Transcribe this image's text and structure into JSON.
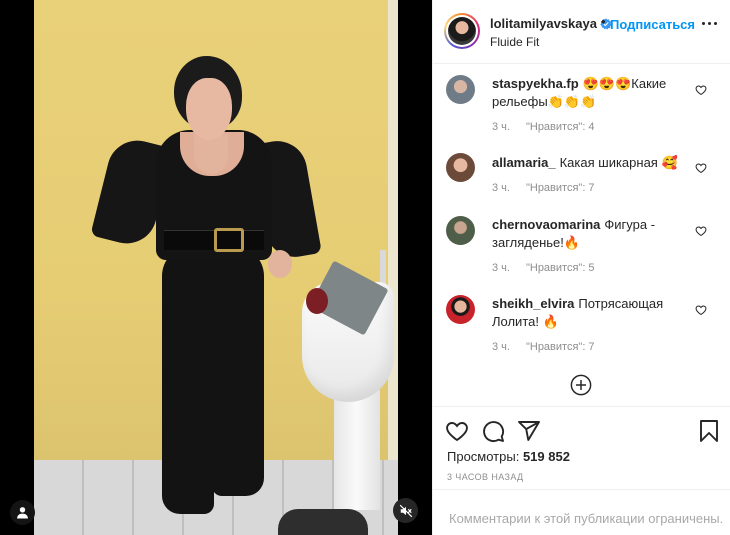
{
  "post": {
    "username": "lolitamilyavskaya",
    "follow_label": "Подписаться",
    "dot": "•",
    "location": "Fluide Fit",
    "views_label": "Просмотры:",
    "views_count": "519 852",
    "time_ago": "3 часов назад",
    "comments_limited": "Комментарии к этой публикации ограничены."
  },
  "comments": [
    {
      "username": "staspyekha.fp",
      "text": "😍😍😍Какие рельефы👏👏👏",
      "time": "3 ч.",
      "likes": "\"Нравится\": 4",
      "avatar_color": "#7d8a96"
    },
    {
      "username": "allamaria_",
      "text": "Какая шикарная 🥰",
      "time": "3 ч.",
      "likes": "\"Нравится\": 7",
      "avatar_color": "#c69a86"
    },
    {
      "username": "chernovaomarina",
      "text": "Фигура - загляденье!🔥",
      "time": "3 ч.",
      "likes": "\"Нравится\": 5",
      "avatar_color": "#5f6f58"
    },
    {
      "username": "sheikh_elvira",
      "text": "Потрясающая Лолита! 🔥",
      "time": "3 ч.",
      "likes": "\"Нравится\": 7",
      "avatar_color": "#c0262d"
    }
  ],
  "icons": {
    "verified": "verified-badge-icon",
    "more": "more-options-icon",
    "like": "heart-icon",
    "comment": "comment-icon",
    "share": "share-icon",
    "save": "bookmark-icon",
    "load_more": "plus-circle-icon",
    "user_tag": "user-tag-icon",
    "mute": "speaker-muted-icon"
  },
  "colors": {
    "accent": "#0095f6",
    "text": "#262626",
    "muted": "#8e8e8e"
  }
}
